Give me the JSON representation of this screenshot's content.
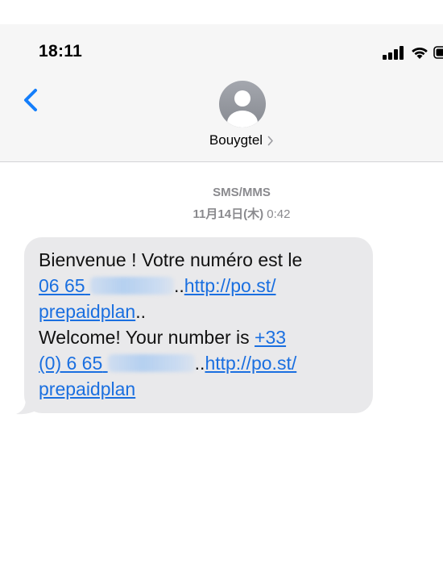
{
  "status_bar": {
    "time": "18:11"
  },
  "header": {
    "back_icon": "chevron-left-icon",
    "avatar_icon": "person-icon",
    "contact_name": "Bouygtel",
    "chevron_icon": "chevron-right-icon"
  },
  "conversation": {
    "message_type": "SMS/MMS",
    "date": "11月14日(木)",
    "time": "0:42"
  },
  "message": {
    "fr_prefix": "Bienvenue ! Votre numéro est le",
    "fr_number_start": "06 65",
    "fr_dots": "..",
    "fr_link_part1": "http://po.st/",
    "fr_link_part2": "prepaidplan",
    "fr_suffix": "..",
    "en_prefix": "Welcome! Your number is ",
    "en_number_part1": "+33",
    "en_number_part2": "(0) 6 65",
    "en_dots": "..",
    "en_link_part1": "http://po.st/",
    "en_link_part2": "prepaidplan"
  },
  "colors": {
    "link": "#1a6fe0",
    "bubble": "#e9e9eb",
    "header_bg": "#f6f6f6",
    "accent": "#147efb"
  }
}
